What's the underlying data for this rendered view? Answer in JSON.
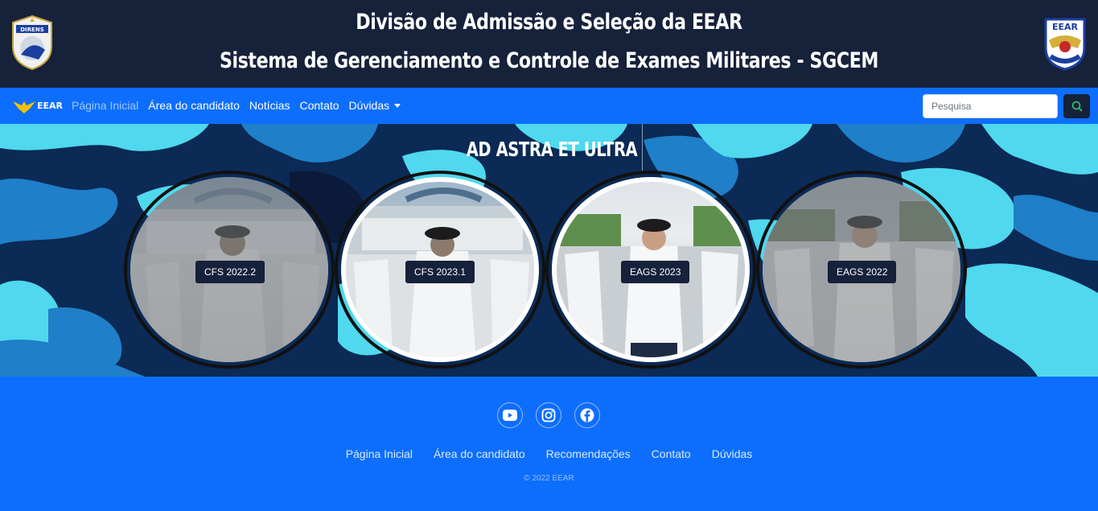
{
  "header": {
    "title_line1": "Divisão de Admissão e Seleção da EEAR",
    "title_line2": "Sistema de Gerenciamento e Controle de Exames Militares - SGCEM",
    "left_badge_text": "DIRENS",
    "right_badge_text": "EEAR",
    "right_badge_motto": "AD ASTRA ET ULTRA"
  },
  "navbar": {
    "brand": "EEAR",
    "links": [
      {
        "label": "Página Inicial",
        "active": true
      },
      {
        "label": "Área do candidato"
      },
      {
        "label": "Notícias"
      },
      {
        "label": "Contato"
      },
      {
        "label": "Dúvidas",
        "dropdown": true
      }
    ],
    "search_placeholder": "Pesquisa",
    "search_icon": "magnifier-icon"
  },
  "hero": {
    "motto": "AD ASTRA ET ULTRA",
    "cards": [
      {
        "label": "CFS 2022.2"
      },
      {
        "label": "CFS 2023.1"
      },
      {
        "label": "EAGS 2023"
      },
      {
        "label": "EAGS 2022"
      }
    ]
  },
  "footer": {
    "social": [
      "youtube-icon",
      "instagram-icon",
      "facebook-icon"
    ],
    "links": [
      "Página Inicial",
      "Área do candidato",
      "Recomendações",
      "Contato",
      "Dúvidas"
    ],
    "copyright": "© 2022 EEAR"
  },
  "colors": {
    "header_bg": "#16213a",
    "primary": "#0d6efd",
    "camo_light": "#4fd8ee",
    "camo_dark": "#0b2a55"
  }
}
